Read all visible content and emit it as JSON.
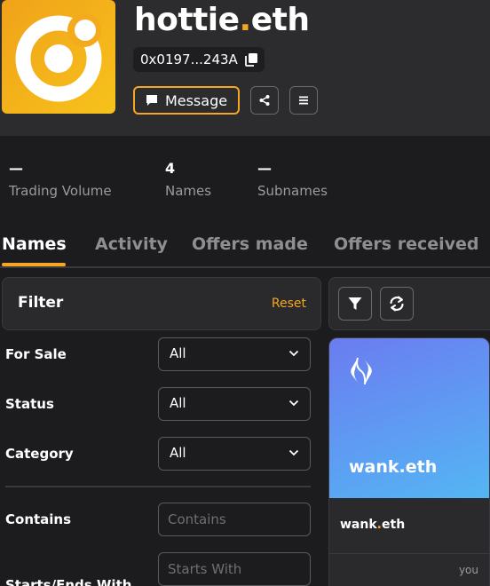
{
  "profile": {
    "name_main": "hottie",
    "name_dot": ".",
    "name_tld": "eth",
    "address": "0x0197...243A",
    "message_label": "Message"
  },
  "colors": {
    "accent": "#f5a623",
    "avatar": "#f0a21a",
    "card_gradient": "#5e9cf3"
  },
  "stats": [
    {
      "value": "—",
      "label": "Trading Volume"
    },
    {
      "value": "4",
      "label": "Names"
    },
    {
      "value": "—",
      "label": "Subnames"
    }
  ],
  "tabs": [
    "Names",
    "Activity",
    "Offers made",
    "Offers received"
  ],
  "filter": {
    "title": "Filter",
    "reset": "Reset",
    "for_sale": {
      "label": "For Sale",
      "value": "All"
    },
    "status": {
      "label": "Status",
      "value": "All"
    },
    "category": {
      "label": "Category",
      "value": "All"
    },
    "contains": {
      "label": "Contains",
      "placeholder": "Contains"
    },
    "starts_ends": {
      "label": "Starts/Ends With",
      "placeholder": "Starts With"
    }
  },
  "card": {
    "art_name": "wank.eth",
    "name_main": "wank",
    "name_dot": ".",
    "name_tld": "eth",
    "owner": "you"
  },
  "icons": [
    "copy-icon",
    "message-icon",
    "share-icon",
    "menu-icon",
    "filter-icon",
    "refresh-icon",
    "chevron-down-icon",
    "ens-logo-icon"
  ]
}
